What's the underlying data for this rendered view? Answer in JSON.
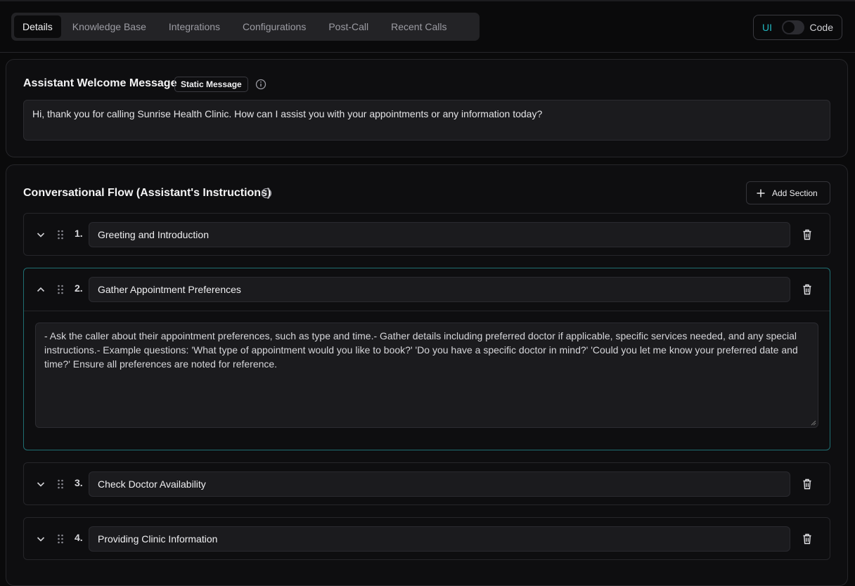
{
  "tabs": [
    {
      "label": "Details",
      "active": true
    },
    {
      "label": "Knowledge Base"
    },
    {
      "label": "Integrations"
    },
    {
      "label": "Configurations"
    },
    {
      "label": "Post-Call"
    },
    {
      "label": "Recent Calls"
    }
  ],
  "mode_toggle": {
    "left": "UI",
    "right": "Code",
    "accent": "#22b8c2"
  },
  "welcome": {
    "title": "Assistant Welcome Message",
    "badge": "Static Message",
    "message": "Hi, thank you for calling Sunrise Health Clinic. How can I assist you with your appointments or any information today?"
  },
  "flow": {
    "title": "Conversational Flow (Assistant's Instructions)",
    "add_label": "Add Section",
    "sections": [
      {
        "num": "1.",
        "title": "Greeting and Introduction",
        "expanded": false
      },
      {
        "num": "2.",
        "title": "Gather Appointment Preferences",
        "expanded": true,
        "body": "- Ask the caller about their appointment preferences, such as type and time.- Gather details including preferred doctor if applicable, specific services needed, and any special instructions.- Example questions: 'What type of appointment would you like to book?' 'Do you have a specific doctor in mind?' 'Could you let me know your preferred date and time?' Ensure all preferences are noted for reference."
      },
      {
        "num": "3.",
        "title": "Check Doctor Availability",
        "expanded": false
      },
      {
        "num": "4.",
        "title": "Providing Clinic Information",
        "expanded": false
      }
    ]
  },
  "icons": {
    "chevron": "chevron-icon",
    "grip": "drag-handle-icon",
    "trash": "trash-icon",
    "info": "info-icon",
    "plus": "plus-icon"
  }
}
